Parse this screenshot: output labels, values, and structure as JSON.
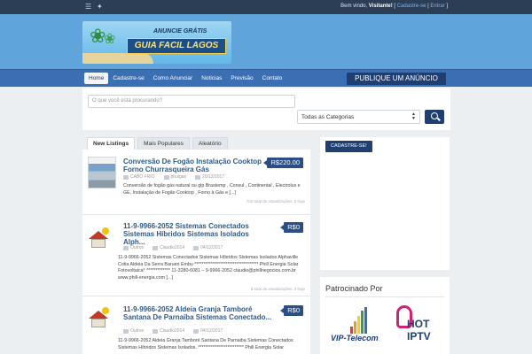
{
  "topbar": {
    "welcome_prefix": "Bem vindo, ",
    "welcome_user": "Visitante!",
    "sep1": " [ ",
    "register_link": "Cadastre-se",
    "sep2": " | ",
    "login_link": "Entrar",
    "sep3": " ]",
    "icons": [
      "rss-icon",
      "twitter-icon"
    ]
  },
  "logo": {
    "tagline": "ANUNCIE GRÁTIS",
    "brand": "GUIA FACIL LAGOS"
  },
  "nav": {
    "items": [
      "Home",
      "Cadastre-se",
      "Como Anunciar",
      "Noticias",
      "Previsão",
      "Contato"
    ],
    "active_index": 0,
    "publish_button": "PUBLIQUE UM ANÚNCIO"
  },
  "search": {
    "placeholder": "O que você está procurando?",
    "category_value": "Todas as Categorias",
    "button_icon": "search-icon"
  },
  "tabs": [
    "New Listings",
    "Mais Populares",
    "Aleatório"
  ],
  "listings": [
    {
      "title": "Conversão De Fogão Instalação Cooktop Forno Churrasqueira Gás",
      "price": "R$220.00",
      "category": "CABO FRIO",
      "author": "phulgas",
      "date": "20/12/2017",
      "description": "Conversão de fogão gás natural ou glp Brastemp , Consul , Continental , Electrolux e GE, Instalação de Fogão Cooktop , Forno à Gás e [...]",
      "views": "702 total de visualizações, 0 hoje"
    },
    {
      "title": "11-9-9966-2052 Sistemas Conectados Sistemas Híbridos Sistemas Isolados Alph...",
      "price": "R$0",
      "category": "Outros",
      "author": "Claudio2014",
      "date": "04/12/2017",
      "description": "11-9-9966-2052 Sistemas Conectados Sistemas Híbridos Sistemas Isolados Alphaville Cotia Aldeia Da Serra Barueri Embu *********************************** Phill Energia Solar Fotovoltaica* ************* 11-3280-6081 – 9-9966-2052 claudio@phillnegocios.com.br www.phill-energia.com [...]",
      "views": "8 total de visualizações, 0 hoje"
    },
    {
      "title": "11-9-9966-2052 Aldeia Granja Tamboré Santana De Parnaiba Sistemas Conectado...",
      "price": "R$0",
      "category": "Outros",
      "author": "Claudio2014",
      "date": "04/12/2017",
      "description": "11-9-9966-2052 Aldeia Granja Tamboré Santana De Parnaiba Sistemas Conectados Sistemas Híbridos Sistemas Isolados. ************************* Phill Energia Solar"
    }
  ],
  "sidebar": {
    "register_button": "CADASTRE-SE!",
    "sponsored_title": "Patrocinado Por",
    "ads": [
      {
        "text": "VIP-Telecom"
      },
      {
        "line1": "HOT",
        "line2": "IPTV"
      }
    ]
  }
}
